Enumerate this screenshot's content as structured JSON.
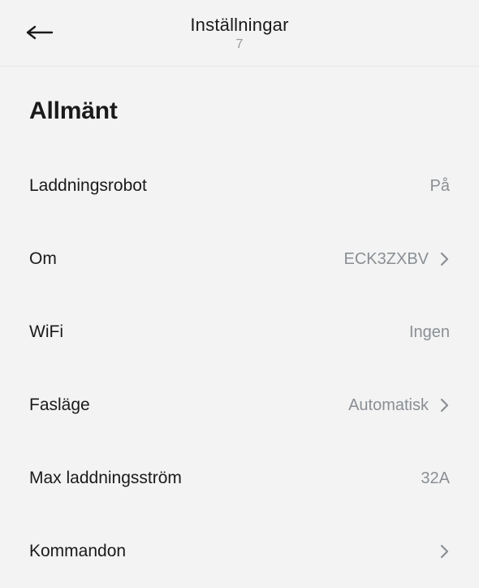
{
  "header": {
    "title": "Inställningar",
    "subtitle": "7"
  },
  "section": {
    "title": "Allmänt"
  },
  "rows": {
    "charging_robot": {
      "label": "Laddningsrobot",
      "value": "På"
    },
    "about": {
      "label": "Om",
      "value": "ECK3ZXBV"
    },
    "wifi": {
      "label": "WiFi",
      "value": "Ingen"
    },
    "phase_mode": {
      "label": "Fasläge",
      "value": "Automatisk"
    },
    "max_current": {
      "label": "Max laddningsström",
      "value": "32A"
    },
    "commands": {
      "label": "Kommandon",
      "value": ""
    }
  }
}
